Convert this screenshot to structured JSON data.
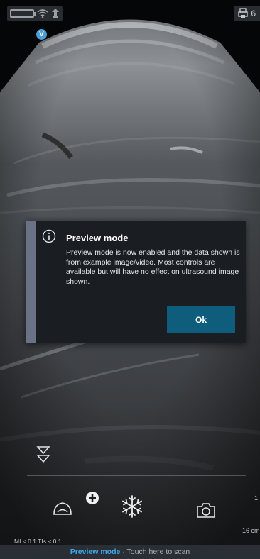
{
  "status": {
    "right_text": "6"
  },
  "badge": {
    "letter": "V"
  },
  "dialog": {
    "title": "Preview mode",
    "body": "Preview mode is now enabled and the data shown is from example image/video. Most controls are available but will have no effect on ultrasound image shown.",
    "ok_label": "Ok"
  },
  "scale": {
    "mark": "1",
    "depth": "16 cm"
  },
  "readouts": {
    "mi_tis": "MI < 0.1  TIs < 0.1"
  },
  "footer": {
    "mode_label": "Preview mode",
    "action_text": "· Touch here to scan"
  },
  "colors": {
    "accent_blue": "#3ea6e8",
    "ok_button": "#0e5d7c",
    "dialog_bg": "#1a1d21",
    "dialog_accent": "#6a7385"
  },
  "icons": [
    "battery-icon",
    "wifi-icon",
    "pin-icon",
    "printer-icon",
    "info-icon",
    "focus-marker-icon",
    "probe-icon",
    "plus-icon",
    "freeze-icon",
    "camera-icon"
  ]
}
